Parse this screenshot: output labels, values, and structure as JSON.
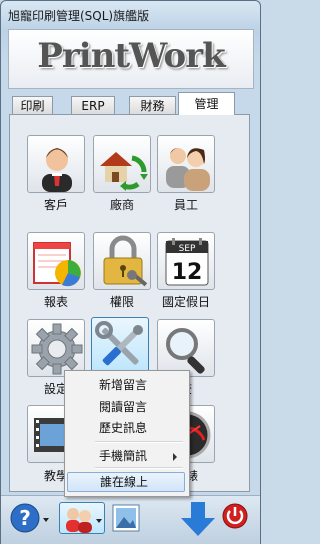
{
  "window": {
    "title": "旭寵印刷管理(SQL)旗艦版"
  },
  "logo": {
    "text": "PrintWork"
  },
  "tabs": [
    {
      "label": "印刷"
    },
    {
      "label": "ERP"
    },
    {
      "label": "財務"
    },
    {
      "label": "管理",
      "active": true
    }
  ],
  "tiles": [
    {
      "label": "客戶",
      "icon": "customer-person-icon"
    },
    {
      "label": "廠商",
      "icon": "vendor-house-icon"
    },
    {
      "label": "員工",
      "icon": "employees-icon"
    },
    {
      "label": "報表",
      "icon": "report-chart-icon"
    },
    {
      "label": "權限",
      "icon": "padlock-key-icon"
    },
    {
      "label": "國定假日",
      "icon": "calendar-icon",
      "calendar_month": "SEP",
      "calendar_day": "12"
    },
    {
      "label": "設定",
      "icon": "gear-icon"
    },
    {
      "label": "",
      "icon": "tools-icon"
    },
    {
      "label": "查",
      "icon": "magnifier-icon"
    },
    {
      "label": "教學",
      "icon": "film-icon"
    },
    {
      "label": "儀錶",
      "icon": "gauge-icon"
    }
  ],
  "context_menu": {
    "items": [
      {
        "label": "新增留言"
      },
      {
        "label": "閱讀留言"
      },
      {
        "label": "歷史訊息"
      },
      {
        "label": "手機簡訊",
        "submenu": true
      },
      {
        "label": "誰在線上",
        "selected": true
      }
    ]
  },
  "bottom_toolbar": {
    "help_icon": "help-question-icon",
    "users_icon": "users-dropdown-icon",
    "image_icon": "picture-icon",
    "download_icon": "down-arrow-icon",
    "power_icon": "power-icon"
  },
  "colors": {
    "accent": "#3a7bd5",
    "menu_highlight": "#d2e5f8",
    "power": "#d02020"
  }
}
